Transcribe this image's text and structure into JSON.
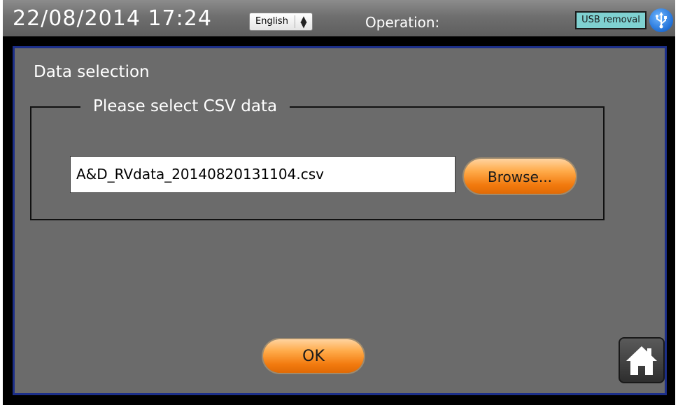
{
  "status_bar": {
    "datetime": "22/08/2014  17:24",
    "language": "English",
    "operation_label": "Operation:",
    "usb_removal_label": "USB removal",
    "usb_icon": "usb-icon"
  },
  "panel": {
    "title": "Data selection",
    "group_label": "Please select CSV data",
    "file_value": "A&D_RVdata_20140820131104.csv",
    "browse_label": "Browse...",
    "ok_label": "OK",
    "home_icon": "home-icon"
  },
  "colors": {
    "panel_background": "#6b6b6b",
    "panel_border": "#1c2f8a",
    "button_orange": "#f28a1e",
    "usb_badge": "#7fd1d1"
  }
}
